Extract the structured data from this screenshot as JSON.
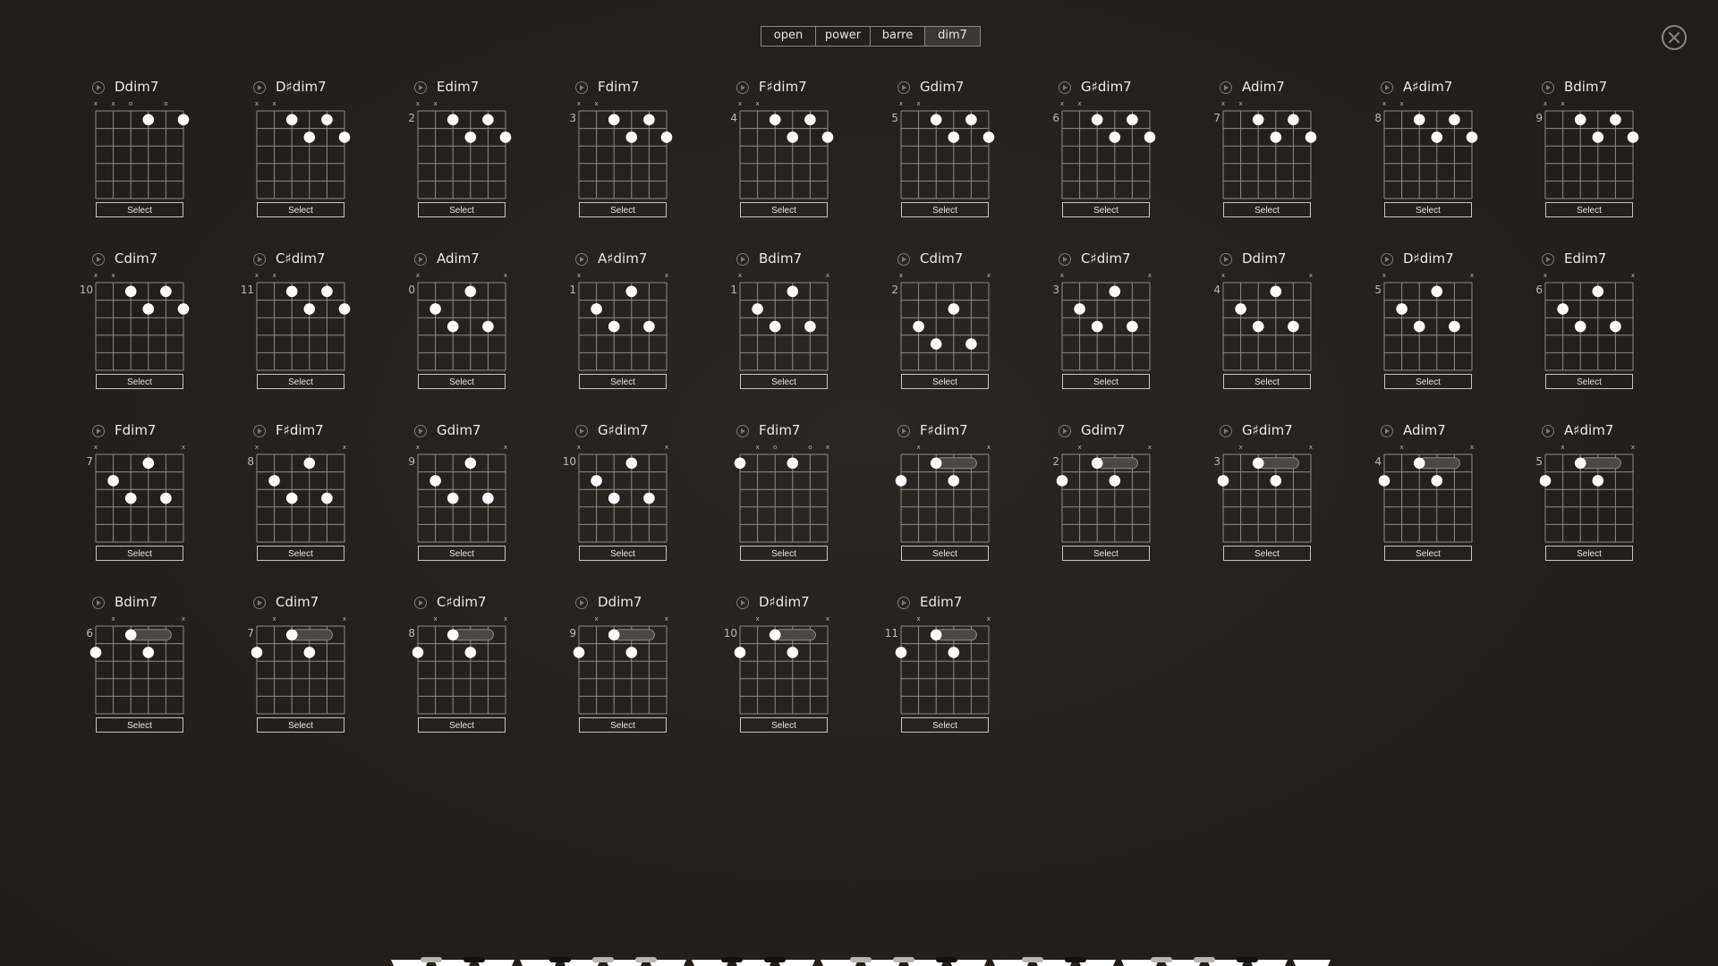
{
  "tabs": [
    {
      "label": "open",
      "active": false
    },
    {
      "label": "power",
      "active": false
    },
    {
      "label": "barre",
      "active": false
    },
    {
      "label": "dim7",
      "active": true
    }
  ],
  "close_icon": "close-circle-icon",
  "select_label": "Select",
  "colors": {
    "background": "#24211e",
    "dot": "#ffffff",
    "grid": "#8f8c88",
    "barre": "#4a4744"
  },
  "chords": [
    {
      "name": "Ddim7",
      "fret": "",
      "markers": [
        "x",
        "x",
        "o",
        "",
        "o",
        ""
      ],
      "dots": [
        [
          4,
          1
        ],
        [
          6,
          1
        ]
      ],
      "barre": null
    },
    {
      "name": "D♯dim7",
      "fret": "",
      "markers": [
        "x",
        "x",
        "",
        "",
        "",
        ""
      ],
      "dots": [
        [
          3,
          1
        ],
        [
          4,
          2
        ],
        [
          5,
          1
        ],
        [
          6,
          2
        ]
      ],
      "barre": null
    },
    {
      "name": "Edim7",
      "fret": "2",
      "markers": [
        "x",
        "x",
        "",
        "",
        "",
        ""
      ],
      "dots": [
        [
          3,
          1
        ],
        [
          4,
          2
        ],
        [
          5,
          1
        ],
        [
          6,
          2
        ]
      ],
      "barre": null
    },
    {
      "name": "Fdim7",
      "fret": "3",
      "markers": [
        "x",
        "x",
        "",
        "",
        "",
        ""
      ],
      "dots": [
        [
          3,
          1
        ],
        [
          4,
          2
        ],
        [
          5,
          1
        ],
        [
          6,
          2
        ]
      ],
      "barre": null
    },
    {
      "name": "F♯dim7",
      "fret": "4",
      "markers": [
        "x",
        "x",
        "",
        "",
        "",
        ""
      ],
      "dots": [
        [
          3,
          1
        ],
        [
          4,
          2
        ],
        [
          5,
          1
        ],
        [
          6,
          2
        ]
      ],
      "barre": null
    },
    {
      "name": "Gdim7",
      "fret": "5",
      "markers": [
        "x",
        "x",
        "",
        "",
        "",
        ""
      ],
      "dots": [
        [
          3,
          1
        ],
        [
          4,
          2
        ],
        [
          5,
          1
        ],
        [
          6,
          2
        ]
      ],
      "barre": null
    },
    {
      "name": "G♯dim7",
      "fret": "6",
      "markers": [
        "x",
        "x",
        "",
        "",
        "",
        ""
      ],
      "dots": [
        [
          3,
          1
        ],
        [
          4,
          2
        ],
        [
          5,
          1
        ],
        [
          6,
          2
        ]
      ],
      "barre": null
    },
    {
      "name": "Adim7",
      "fret": "7",
      "markers": [
        "x",
        "x",
        "",
        "",
        "",
        ""
      ],
      "dots": [
        [
          3,
          1
        ],
        [
          4,
          2
        ],
        [
          5,
          1
        ],
        [
          6,
          2
        ]
      ],
      "barre": null
    },
    {
      "name": "A♯dim7",
      "fret": "8",
      "markers": [
        "x",
        "x",
        "",
        "",
        "",
        ""
      ],
      "dots": [
        [
          3,
          1
        ],
        [
          4,
          2
        ],
        [
          5,
          1
        ],
        [
          6,
          2
        ]
      ],
      "barre": null
    },
    {
      "name": "Bdim7",
      "fret": "9",
      "markers": [
        "x",
        "x",
        "",
        "",
        "",
        ""
      ],
      "dots": [
        [
          3,
          1
        ],
        [
          4,
          2
        ],
        [
          5,
          1
        ],
        [
          6,
          2
        ]
      ],
      "barre": null
    },
    {
      "name": "Cdim7",
      "fret": "10",
      "markers": [
        "x",
        "x",
        "",
        "",
        "",
        ""
      ],
      "dots": [
        [
          3,
          1
        ],
        [
          4,
          2
        ],
        [
          5,
          1
        ],
        [
          6,
          2
        ]
      ],
      "barre": null
    },
    {
      "name": "C♯dim7",
      "fret": "11",
      "markers": [
        "x",
        "x",
        "",
        "",
        "",
        ""
      ],
      "dots": [
        [
          3,
          1
        ],
        [
          4,
          2
        ],
        [
          5,
          1
        ],
        [
          6,
          2
        ]
      ],
      "barre": null
    },
    {
      "name": "Adim7",
      "fret": "0",
      "markers": [
        "x",
        "",
        "",
        "",
        "",
        "x"
      ],
      "dots": [
        [
          2,
          2
        ],
        [
          3,
          3
        ],
        [
          4,
          1
        ],
        [
          5,
          3
        ]
      ],
      "barre": null
    },
    {
      "name": "A♯dim7",
      "fret": "1",
      "markers": [
        "x",
        "",
        "",
        "",
        "",
        "x"
      ],
      "dots": [
        [
          2,
          2
        ],
        [
          3,
          3
        ],
        [
          4,
          1
        ],
        [
          5,
          3
        ]
      ],
      "barre": null
    },
    {
      "name": "Bdim7",
      "fret": "1",
      "markers": [
        "x",
        "",
        "",
        "",
        "",
        "x"
      ],
      "dots": [
        [
          2,
          2
        ],
        [
          3,
          3
        ],
        [
          4,
          1
        ],
        [
          5,
          3
        ]
      ],
      "barre": null
    },
    {
      "name": "Cdim7",
      "fret": "2",
      "markers": [
        "x",
        "",
        "",
        "",
        "",
        "x"
      ],
      "dots": [
        [
          2,
          3
        ],
        [
          3,
          4
        ],
        [
          4,
          2
        ],
        [
          5,
          4
        ]
      ],
      "barre": null
    },
    {
      "name": "C♯dim7",
      "fret": "3",
      "markers": [
        "x",
        "",
        "",
        "",
        "",
        "x"
      ],
      "dots": [
        [
          2,
          2
        ],
        [
          3,
          3
        ],
        [
          4,
          1
        ],
        [
          5,
          3
        ]
      ],
      "barre": null
    },
    {
      "name": "Ddim7",
      "fret": "4",
      "markers": [
        "x",
        "",
        "",
        "",
        "",
        "x"
      ],
      "dots": [
        [
          2,
          2
        ],
        [
          3,
          3
        ],
        [
          4,
          1
        ],
        [
          5,
          3
        ]
      ],
      "barre": null
    },
    {
      "name": "D♯dim7",
      "fret": "5",
      "markers": [
        "x",
        "",
        "",
        "",
        "",
        "x"
      ],
      "dots": [
        [
          2,
          2
        ],
        [
          3,
          3
        ],
        [
          4,
          1
        ],
        [
          5,
          3
        ]
      ],
      "barre": null
    },
    {
      "name": "Edim7",
      "fret": "6",
      "markers": [
        "x",
        "",
        "",
        "",
        "",
        "x"
      ],
      "dots": [
        [
          2,
          2
        ],
        [
          3,
          3
        ],
        [
          4,
          1
        ],
        [
          5,
          3
        ]
      ],
      "barre": null
    },
    {
      "name": "Fdim7",
      "fret": "7",
      "markers": [
        "x",
        "",
        "",
        "",
        "",
        "x"
      ],
      "dots": [
        [
          2,
          2
        ],
        [
          3,
          3
        ],
        [
          4,
          1
        ],
        [
          5,
          3
        ]
      ],
      "barre": null
    },
    {
      "name": "F♯dim7",
      "fret": "8",
      "markers": [
        "x",
        "",
        "",
        "",
        "",
        "x"
      ],
      "dots": [
        [
          2,
          2
        ],
        [
          3,
          3
        ],
        [
          4,
          1
        ],
        [
          5,
          3
        ]
      ],
      "barre": null
    },
    {
      "name": "Gdim7",
      "fret": "9",
      "markers": [
        "x",
        "",
        "",
        "",
        "",
        "x"
      ],
      "dots": [
        [
          2,
          2
        ],
        [
          3,
          3
        ],
        [
          4,
          1
        ],
        [
          5,
          3
        ]
      ],
      "barre": null
    },
    {
      "name": "G♯dim7",
      "fret": "10",
      "markers": [
        "x",
        "",
        "",
        "",
        "",
        "x"
      ],
      "dots": [
        [
          2,
          2
        ],
        [
          3,
          3
        ],
        [
          4,
          1
        ],
        [
          5,
          3
        ]
      ],
      "barre": null
    },
    {
      "name": "Fdim7",
      "fret": "",
      "markers": [
        "",
        "x",
        "o",
        "",
        "o",
        "x"
      ],
      "dots": [
        [
          1,
          1
        ],
        [
          4,
          1
        ]
      ],
      "barre": null
    },
    {
      "name": "F♯dim7",
      "fret": "",
      "markers": [
        "",
        "x",
        "",
        "",
        "",
        "x"
      ],
      "dots": [
        [
          3,
          1
        ],
        [
          1,
          2
        ],
        [
          4,
          2
        ]
      ],
      "barre": [
        1,
        3,
        5
      ]
    },
    {
      "name": "Gdim7",
      "fret": "2",
      "markers": [
        "",
        "x",
        "",
        "",
        "",
        "x"
      ],
      "dots": [
        [
          3,
          1
        ],
        [
          1,
          2
        ],
        [
          4,
          2
        ]
      ],
      "barre": [
        1,
        3,
        5
      ]
    },
    {
      "name": "G♯dim7",
      "fret": "3",
      "markers": [
        "",
        "x",
        "",
        "",
        "",
        "x"
      ],
      "dots": [
        [
          3,
          1
        ],
        [
          1,
          2
        ],
        [
          4,
          2
        ]
      ],
      "barre": [
        1,
        3,
        5
      ]
    },
    {
      "name": "Adim7",
      "fret": "4",
      "markers": [
        "",
        "x",
        "",
        "",
        "",
        "x"
      ],
      "dots": [
        [
          3,
          1
        ],
        [
          1,
          2
        ],
        [
          4,
          2
        ]
      ],
      "barre": [
        1,
        3,
        5
      ]
    },
    {
      "name": "A♯dim7",
      "fret": "5",
      "markers": [
        "",
        "x",
        "",
        "",
        "",
        "x"
      ],
      "dots": [
        [
          3,
          1
        ],
        [
          1,
          2
        ],
        [
          4,
          2
        ]
      ],
      "barre": [
        1,
        3,
        5
      ]
    },
    {
      "name": "Bdim7",
      "fret": "6",
      "markers": [
        "",
        "x",
        "",
        "",
        "",
        "x"
      ],
      "dots": [
        [
          3,
          1
        ],
        [
          1,
          2
        ],
        [
          4,
          2
        ]
      ],
      "barre": [
        1,
        3,
        5
      ]
    },
    {
      "name": "Cdim7",
      "fret": "7",
      "markers": [
        "",
        "x",
        "",
        "",
        "",
        "x"
      ],
      "dots": [
        [
          3,
          1
        ],
        [
          1,
          2
        ],
        [
          4,
          2
        ]
      ],
      "barre": [
        1,
        3,
        5
      ]
    },
    {
      "name": "C♯dim7",
      "fret": "8",
      "markers": [
        "",
        "x",
        "",
        "",
        "",
        "x"
      ],
      "dots": [
        [
          3,
          1
        ],
        [
          1,
          2
        ],
        [
          4,
          2
        ]
      ],
      "barre": [
        1,
        3,
        5
      ]
    },
    {
      "name": "Ddim7",
      "fret": "9",
      "markers": [
        "",
        "x",
        "",
        "",
        "",
        "x"
      ],
      "dots": [
        [
          3,
          1
        ],
        [
          1,
          2
        ],
        [
          4,
          2
        ]
      ],
      "barre": [
        1,
        3,
        5
      ]
    },
    {
      "name": "D♯dim7",
      "fret": "10",
      "markers": [
        "",
        "x",
        "",
        "",
        "",
        "x"
      ],
      "dots": [
        [
          3,
          1
        ],
        [
          1,
          2
        ],
        [
          4,
          2
        ]
      ],
      "barre": [
        1,
        3,
        5
      ]
    },
    {
      "name": "Edim7",
      "fret": "11",
      "markers": [
        "",
        "x",
        "",
        "",
        "",
        "x"
      ],
      "dots": [
        [
          3,
          1
        ],
        [
          1,
          2
        ],
        [
          4,
          2
        ]
      ],
      "barre": [
        1,
        3,
        5
      ]
    }
  ],
  "piano": {
    "white_keys": 22,
    "highlighted_black_keys": [
      0,
      3,
      4,
      7,
      8,
      10,
      12,
      13
    ]
  }
}
